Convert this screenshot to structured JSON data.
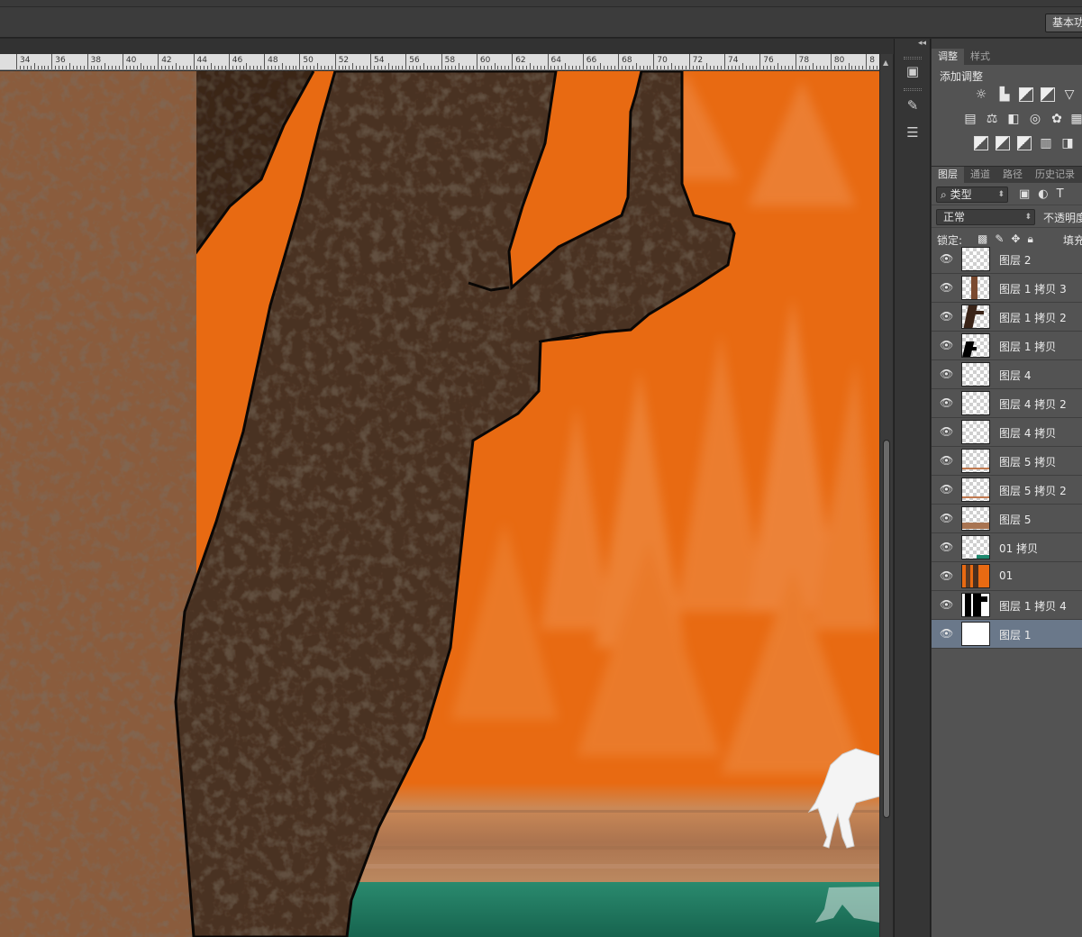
{
  "optionsbar": {
    "workspace_label": "基本功"
  },
  "ruler": {
    "labels": [
      "34",
      "36",
      "38",
      "40",
      "42",
      "44",
      "46",
      "48",
      "50",
      "52",
      "54",
      "56",
      "58",
      "60",
      "62",
      "64",
      "66",
      "68",
      "70",
      "72",
      "74",
      "76",
      "78",
      "80",
      "8"
    ]
  },
  "colors": {
    "sky_orange": "#e86a12",
    "tree_bark_light": "#8a5a3a",
    "tree_bark_dark": "#3a2418",
    "tree_bark_darkest": "#24170f",
    "water_teal": "#1f7a64",
    "ground_tan": "#b88660",
    "panel_bg": "#535353",
    "selected_layer": "#6a788a"
  },
  "adjustments_panel": {
    "tabs": [
      {
        "label": "调整",
        "active": true
      },
      {
        "label": "样式",
        "active": false
      }
    ],
    "title": "添加调整",
    "icon_rows": [
      [
        "brightness-contrast-icon",
        "levels-icon",
        "curves-icon",
        "exposure-icon",
        "vibrance-icon"
      ],
      [
        "hue-saturation-icon",
        "color-balance-icon",
        "black-white-icon",
        "photo-filter-icon",
        "channel-mixer-icon",
        "color-lookup-icon"
      ],
      [
        "invert-icon",
        "posterize-icon",
        "threshold-icon",
        "gradient-map-icon",
        "selective-color-icon"
      ]
    ]
  },
  "layers_panel": {
    "tabs": [
      {
        "label": "图层",
        "active": true
      },
      {
        "label": "通道",
        "active": false
      },
      {
        "label": "路径",
        "active": false
      },
      {
        "label": "历史记录",
        "active": false
      }
    ],
    "filter_label": "类型",
    "blend_mode": "正常",
    "opacity_label": "不透明度",
    "lock_label": "锁定:",
    "fill_label": "填充",
    "layers": [
      {
        "name": "图层 2",
        "thumb": "empty",
        "selected": false
      },
      {
        "name": "图层 1 拷贝 3",
        "thumb": "trunk-brown",
        "selected": false
      },
      {
        "name": "图层 1 拷贝 2",
        "thumb": "trunk-dark",
        "selected": false
      },
      {
        "name": "图层 1 拷贝",
        "thumb": "trunk-black",
        "selected": false
      },
      {
        "name": "图层 4",
        "thumb": "empty",
        "selected": false
      },
      {
        "name": "图层 4 拷贝 2",
        "thumb": "empty",
        "selected": false
      },
      {
        "name": "图层 4 拷贝",
        "thumb": "empty",
        "selected": false
      },
      {
        "name": "图层 5 拷贝",
        "thumb": "ground-line",
        "selected": false
      },
      {
        "name": "图层 5 拷贝 2",
        "thumb": "ground-line",
        "selected": false
      },
      {
        "name": "图层 5",
        "thumb": "ground-band",
        "selected": false
      },
      {
        "name": "01 拷贝",
        "thumb": "teal-corner",
        "selected": false
      },
      {
        "name": "01",
        "thumb": "orange-scene",
        "selected": false
      },
      {
        "name": "图层 1 拷贝 4",
        "thumb": "black-trees",
        "selected": false
      },
      {
        "name": "图层 1",
        "thumb": "white",
        "selected": true
      }
    ]
  }
}
